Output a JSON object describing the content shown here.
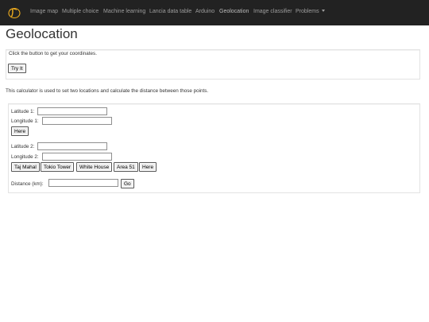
{
  "navbar": {
    "brand_icon": "cursive-d-logo-icon",
    "items": [
      {
        "label": "Image map"
      },
      {
        "label": "Multiple choice"
      },
      {
        "label": "Machine learning"
      },
      {
        "label": "Lancia data table"
      },
      {
        "label": "Arduino"
      },
      {
        "label": "Geolocation"
      },
      {
        "label": "Image classifier"
      },
      {
        "label": "Problems"
      }
    ],
    "colors": {
      "background": "#222222",
      "text": "#9d9d9d",
      "brand": "#f0ad1e"
    }
  },
  "page": {
    "title": "Geolocation",
    "intro": "This calculator is used to set two locations and calculate the distance between those points."
  },
  "coords": {
    "prompt": "Click the button to get your coordinates.",
    "button": "Try It"
  },
  "calc": {
    "lat1_label": "Latitude 1:",
    "lon1_label": "Longitude 1:",
    "here1": "Here",
    "lat2_label": "Latitude 2:",
    "lon2_label": "Longitude 2:",
    "presets": [
      "Taj Mahal",
      "Tokio Tower",
      "White House",
      "Area 51"
    ],
    "here2": "Here",
    "distance_label": "Distance (km):",
    "go": "Go"
  }
}
